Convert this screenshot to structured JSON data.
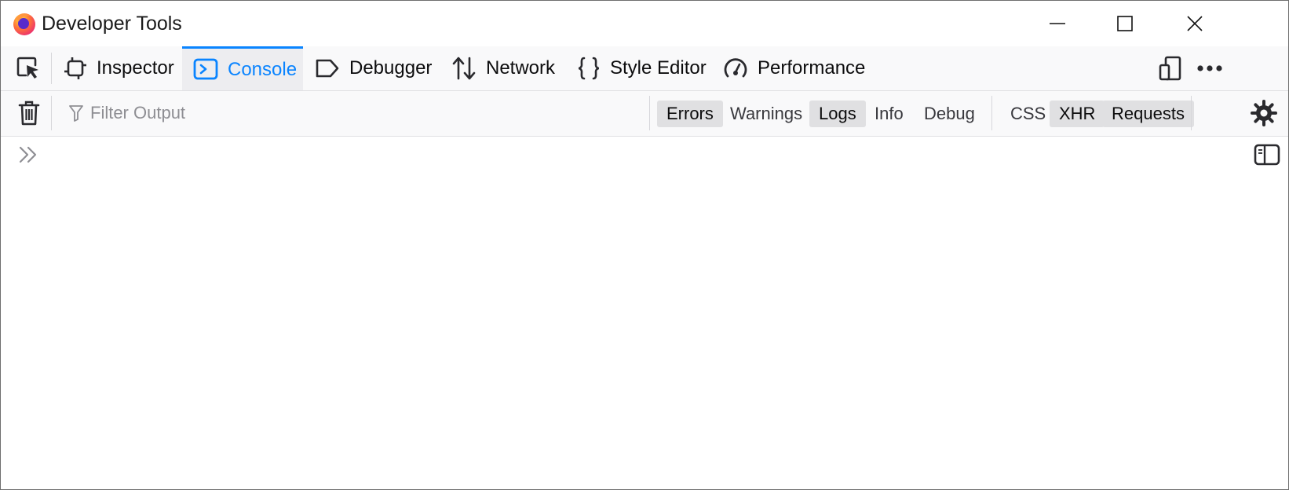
{
  "window": {
    "title": "Developer Tools",
    "controls": [
      "minimize",
      "maximize",
      "close"
    ]
  },
  "toolbar": {
    "tabs": [
      {
        "label": "Inspector",
        "icon": "inspector-icon",
        "selected": false
      },
      {
        "label": "Console",
        "icon": "console-icon",
        "selected": true
      },
      {
        "label": "Debugger",
        "icon": "debugger-icon",
        "selected": false
      },
      {
        "label": "Network",
        "icon": "network-icon",
        "selected": false
      },
      {
        "label": "Style Editor",
        "icon": "style-editor-icon",
        "selected": false
      },
      {
        "label": "Performance",
        "icon": "performance-icon",
        "selected": false
      }
    ]
  },
  "filterbar": {
    "placeholder": "Filter Output",
    "levels": [
      {
        "label": "Errors",
        "on": true
      },
      {
        "label": "Warnings",
        "on": false
      },
      {
        "label": "Logs",
        "on": true
      },
      {
        "label": "Info",
        "on": false
      },
      {
        "label": "Debug",
        "on": false
      }
    ],
    "extra": [
      {
        "label": "CSS",
        "on": false
      },
      {
        "label": "XHR",
        "on": true
      },
      {
        "label": "Requests",
        "on": true
      }
    ]
  },
  "colors": {
    "accent": "#0a84ff",
    "toolbar_bg": "#f9f9fa",
    "selected_tab_bg": "#ededf0",
    "toggle_on_bg": "#e0e0e2"
  }
}
